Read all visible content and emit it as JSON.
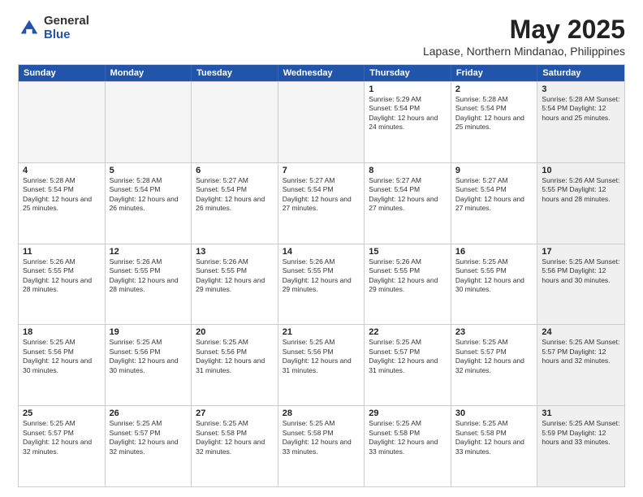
{
  "header": {
    "logo_general": "General",
    "logo_blue": "Blue",
    "title": "May 2025",
    "subtitle": "Lapase, Northern Mindanao, Philippines"
  },
  "calendar": {
    "days": [
      "Sunday",
      "Monday",
      "Tuesday",
      "Wednesday",
      "Thursday",
      "Friday",
      "Saturday"
    ],
    "rows": [
      [
        {
          "day": "",
          "text": "",
          "empty": true
        },
        {
          "day": "",
          "text": "",
          "empty": true
        },
        {
          "day": "",
          "text": "",
          "empty": true
        },
        {
          "day": "",
          "text": "",
          "empty": true
        },
        {
          "day": "1",
          "text": "Sunrise: 5:29 AM\nSunset: 5:54 PM\nDaylight: 12 hours\nand 24 minutes.",
          "empty": false
        },
        {
          "day": "2",
          "text": "Sunrise: 5:28 AM\nSunset: 5:54 PM\nDaylight: 12 hours\nand 25 minutes.",
          "empty": false
        },
        {
          "day": "3",
          "text": "Sunrise: 5:28 AM\nSunset: 5:54 PM\nDaylight: 12 hours\nand 25 minutes.",
          "empty": false,
          "shaded": true
        }
      ],
      [
        {
          "day": "4",
          "text": "Sunrise: 5:28 AM\nSunset: 5:54 PM\nDaylight: 12 hours\nand 25 minutes.",
          "empty": false
        },
        {
          "day": "5",
          "text": "Sunrise: 5:28 AM\nSunset: 5:54 PM\nDaylight: 12 hours\nand 26 minutes.",
          "empty": false
        },
        {
          "day": "6",
          "text": "Sunrise: 5:27 AM\nSunset: 5:54 PM\nDaylight: 12 hours\nand 26 minutes.",
          "empty": false
        },
        {
          "day": "7",
          "text": "Sunrise: 5:27 AM\nSunset: 5:54 PM\nDaylight: 12 hours\nand 27 minutes.",
          "empty": false
        },
        {
          "day": "8",
          "text": "Sunrise: 5:27 AM\nSunset: 5:54 PM\nDaylight: 12 hours\nand 27 minutes.",
          "empty": false
        },
        {
          "day": "9",
          "text": "Sunrise: 5:27 AM\nSunset: 5:54 PM\nDaylight: 12 hours\nand 27 minutes.",
          "empty": false
        },
        {
          "day": "10",
          "text": "Sunrise: 5:26 AM\nSunset: 5:55 PM\nDaylight: 12 hours\nand 28 minutes.",
          "empty": false,
          "shaded": true
        }
      ],
      [
        {
          "day": "11",
          "text": "Sunrise: 5:26 AM\nSunset: 5:55 PM\nDaylight: 12 hours\nand 28 minutes.",
          "empty": false
        },
        {
          "day": "12",
          "text": "Sunrise: 5:26 AM\nSunset: 5:55 PM\nDaylight: 12 hours\nand 28 minutes.",
          "empty": false
        },
        {
          "day": "13",
          "text": "Sunrise: 5:26 AM\nSunset: 5:55 PM\nDaylight: 12 hours\nand 29 minutes.",
          "empty": false
        },
        {
          "day": "14",
          "text": "Sunrise: 5:26 AM\nSunset: 5:55 PM\nDaylight: 12 hours\nand 29 minutes.",
          "empty": false
        },
        {
          "day": "15",
          "text": "Sunrise: 5:26 AM\nSunset: 5:55 PM\nDaylight: 12 hours\nand 29 minutes.",
          "empty": false
        },
        {
          "day": "16",
          "text": "Sunrise: 5:25 AM\nSunset: 5:55 PM\nDaylight: 12 hours\nand 30 minutes.",
          "empty": false
        },
        {
          "day": "17",
          "text": "Sunrise: 5:25 AM\nSunset: 5:56 PM\nDaylight: 12 hours\nand 30 minutes.",
          "empty": false,
          "shaded": true
        }
      ],
      [
        {
          "day": "18",
          "text": "Sunrise: 5:25 AM\nSunset: 5:56 PM\nDaylight: 12 hours\nand 30 minutes.",
          "empty": false
        },
        {
          "day": "19",
          "text": "Sunrise: 5:25 AM\nSunset: 5:56 PM\nDaylight: 12 hours\nand 30 minutes.",
          "empty": false
        },
        {
          "day": "20",
          "text": "Sunrise: 5:25 AM\nSunset: 5:56 PM\nDaylight: 12 hours\nand 31 minutes.",
          "empty": false
        },
        {
          "day": "21",
          "text": "Sunrise: 5:25 AM\nSunset: 5:56 PM\nDaylight: 12 hours\nand 31 minutes.",
          "empty": false
        },
        {
          "day": "22",
          "text": "Sunrise: 5:25 AM\nSunset: 5:57 PM\nDaylight: 12 hours\nand 31 minutes.",
          "empty": false
        },
        {
          "day": "23",
          "text": "Sunrise: 5:25 AM\nSunset: 5:57 PM\nDaylight: 12 hours\nand 32 minutes.",
          "empty": false
        },
        {
          "day": "24",
          "text": "Sunrise: 5:25 AM\nSunset: 5:57 PM\nDaylight: 12 hours\nand 32 minutes.",
          "empty": false,
          "shaded": true
        }
      ],
      [
        {
          "day": "25",
          "text": "Sunrise: 5:25 AM\nSunset: 5:57 PM\nDaylight: 12 hours\nand 32 minutes.",
          "empty": false
        },
        {
          "day": "26",
          "text": "Sunrise: 5:25 AM\nSunset: 5:57 PM\nDaylight: 12 hours\nand 32 minutes.",
          "empty": false
        },
        {
          "day": "27",
          "text": "Sunrise: 5:25 AM\nSunset: 5:58 PM\nDaylight: 12 hours\nand 32 minutes.",
          "empty": false
        },
        {
          "day": "28",
          "text": "Sunrise: 5:25 AM\nSunset: 5:58 PM\nDaylight: 12 hours\nand 33 minutes.",
          "empty": false
        },
        {
          "day": "29",
          "text": "Sunrise: 5:25 AM\nSunset: 5:58 PM\nDaylight: 12 hours\nand 33 minutes.",
          "empty": false
        },
        {
          "day": "30",
          "text": "Sunrise: 5:25 AM\nSunset: 5:58 PM\nDaylight: 12 hours\nand 33 minutes.",
          "empty": false
        },
        {
          "day": "31",
          "text": "Sunrise: 5:25 AM\nSunset: 5:59 PM\nDaylight: 12 hours\nand 33 minutes.",
          "empty": false,
          "shaded": true
        }
      ]
    ]
  }
}
